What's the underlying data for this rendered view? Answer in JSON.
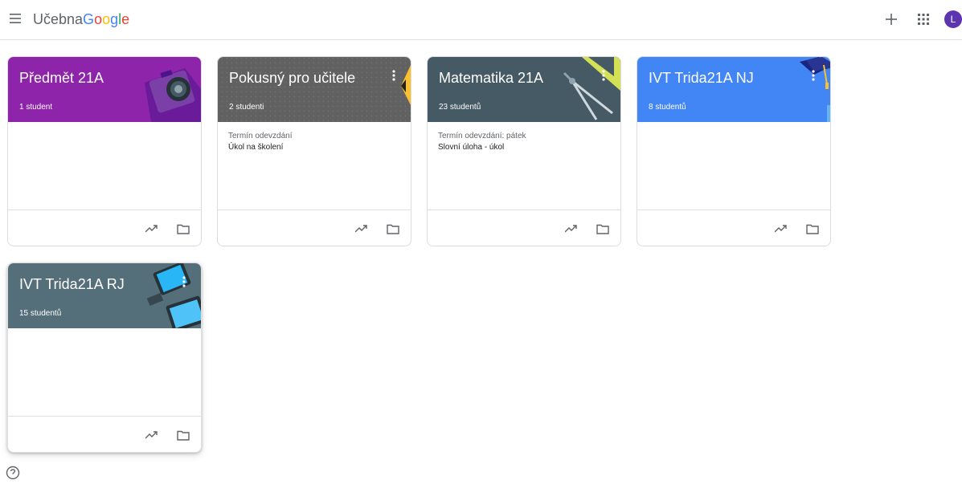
{
  "header": {
    "app_name": "Učebna",
    "google_letters": [
      "G",
      "o",
      "o",
      "g",
      "l",
      "e"
    ],
    "avatar_initial": "L",
    "icons": {
      "menu": "hamburger-menu-icon",
      "create": "plus-icon",
      "apps": "apps-grid-icon"
    }
  },
  "classes": [
    {
      "title": "Předmět 21A",
      "students": "1 student",
      "color": "#8e24aa",
      "due_label": "",
      "due_item": "",
      "illustration": "camera"
    },
    {
      "title": "Pokusný pro učitele",
      "students": "2 studenti",
      "color": "#616161",
      "due_label": "Termín odevzdání",
      "due_item": "Úkol na školení",
      "illustration": "pencil"
    },
    {
      "title": "Matematika 21A",
      "students": "23 studentů",
      "color": "#455a64",
      "due_label": "Termín odevzdání: pátek",
      "due_item": "Slovní úloha - úkol",
      "illustration": "compass"
    },
    {
      "title": "IVT Trida21A NJ",
      "students": "8 studentů",
      "color": "#4285f4",
      "due_label": "",
      "due_item": "",
      "illustration": "graduation-cap"
    },
    {
      "title": "IVT Trida21A RJ",
      "students": "15 studentů",
      "color": "#546e7a",
      "due_label": "",
      "due_item": "",
      "illustration": "tablets"
    }
  ],
  "card_icons": {
    "more": "more-vert-icon",
    "progress": "trending-up-icon",
    "folder": "folder-icon"
  },
  "footer": {
    "help_icon": "help-icon"
  }
}
